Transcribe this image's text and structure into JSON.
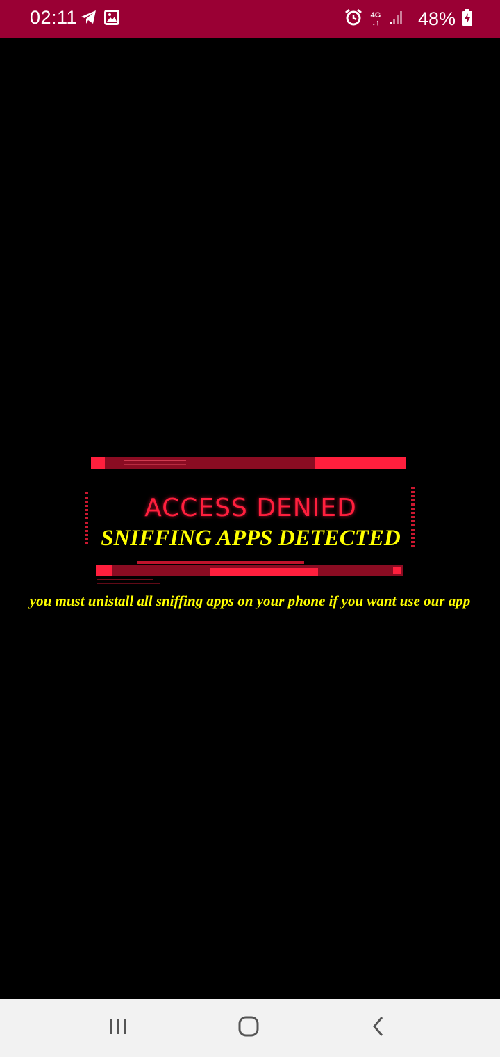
{
  "status_bar": {
    "time": "02:11",
    "left_icons": [
      "telegram-icon",
      "image-icon"
    ],
    "right_icons": [
      "alarm-icon",
      "network-4g-icon",
      "signal-icon",
      "battery-charging-icon"
    ],
    "network_type_top": "4G",
    "battery_percent": "48%",
    "background_color": "#9a0034"
  },
  "banner": {
    "heading": "ACCESS DENIED",
    "subtitle": "SNIFFING APPS DETECTED",
    "accent_color": "#ff1f3d",
    "subtitle_color": "#ffff00"
  },
  "message": {
    "text": "you must unistall all sniffing apps on your phone if you want use our app",
    "color": "#ffff00"
  },
  "nav_bar": {
    "buttons": [
      "recents-icon",
      "home-icon",
      "back-icon"
    ]
  }
}
